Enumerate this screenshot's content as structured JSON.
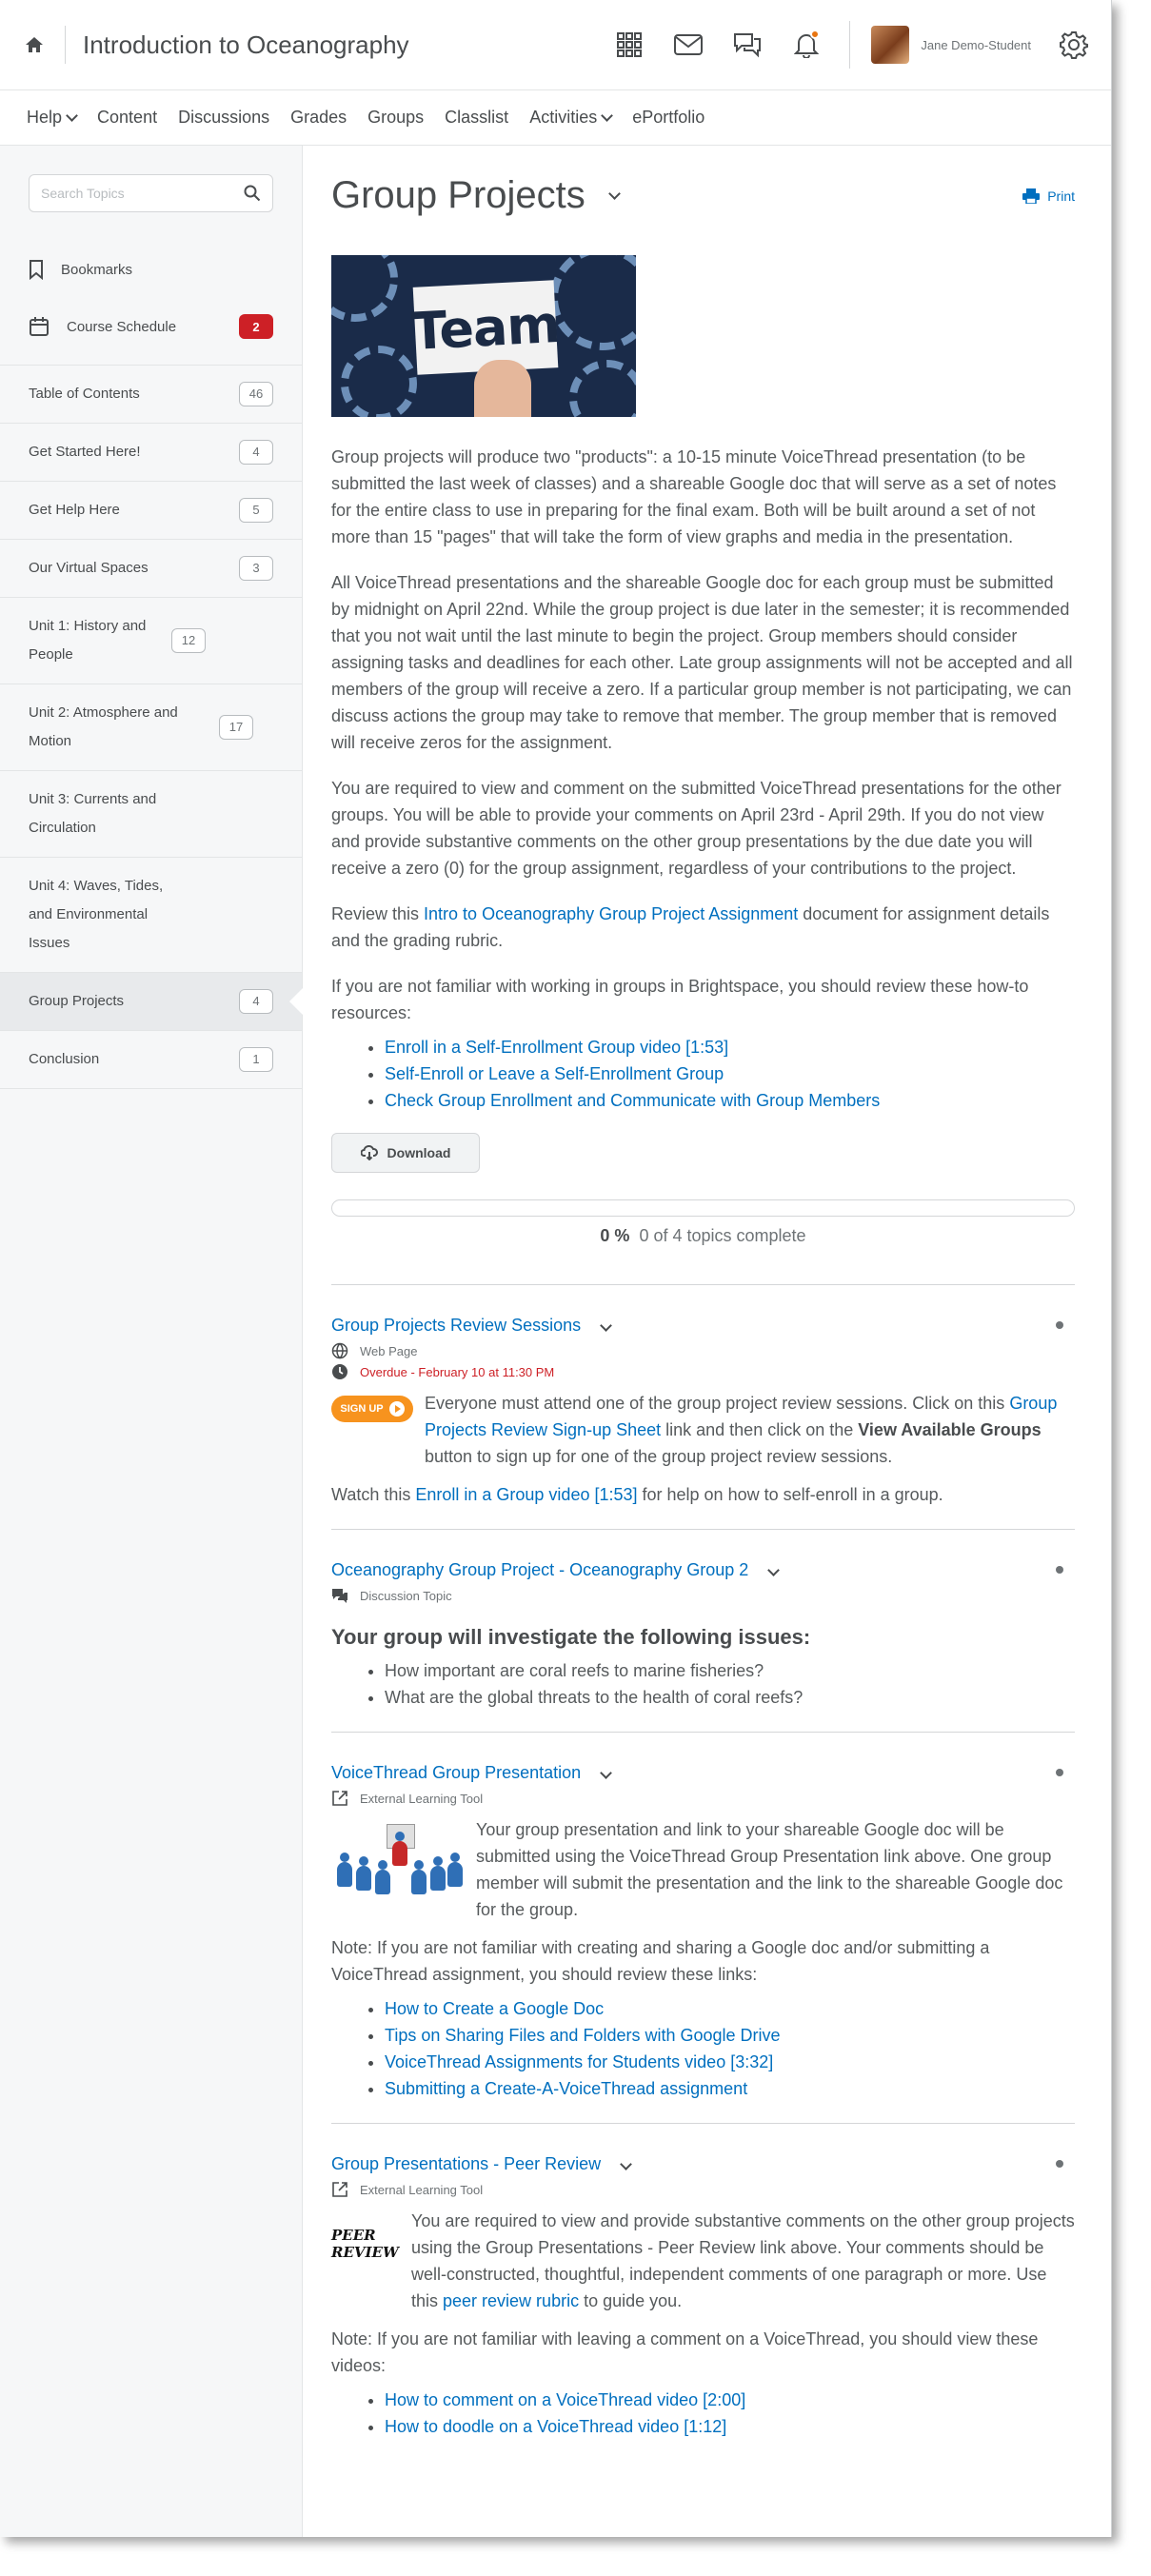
{
  "header": {
    "course_title": "Introduction to Oceanography",
    "user_name": "Jane Demo-Student"
  },
  "navbar": {
    "items": [
      "Help",
      "Content",
      "Discussions",
      "Grades",
      "Groups",
      "Classlist",
      "Activities",
      "ePortfolio"
    ]
  },
  "sidebar": {
    "search_placeholder": "Search Topics",
    "bookmarks_label": "Bookmarks",
    "schedule_label": "Course Schedule",
    "schedule_badge": "2",
    "toc": [
      {
        "label": "Table of Contents",
        "count": "46"
      },
      {
        "label": "Get Started Here!",
        "count": "4"
      },
      {
        "label": "Get Help Here",
        "count": "5"
      },
      {
        "label": "Our Virtual Spaces",
        "count": "3"
      },
      {
        "label": "Unit 1: History and People",
        "count": "12"
      },
      {
        "label": "Unit 2: Atmosphere and Motion",
        "count": "17"
      },
      {
        "label": "Unit 3: Currents and Circulation",
        "count": ""
      },
      {
        "label": "Unit 4: Waves, Tides, and Environmental Issues",
        "count": ""
      },
      {
        "label": "Group Projects",
        "count": "4"
      },
      {
        "label": "Conclusion",
        "count": "1"
      }
    ]
  },
  "main": {
    "title": "Group Projects",
    "print_label": "Print",
    "image_text": "Team",
    "para1": "Group projects will produce two \"products\": a 10-15 minute VoiceThread presentation (to be submitted the last week of classes) and a shareable Google doc that will serve as a set of notes for the entire class to use in preparing for the final exam. Both will be built around a set of not more than 15 \"pages\" that will take the form of view graphs and media in the presentation.",
    "para2": "All VoiceThread presentations and the shareable Google doc for each group must be submitted by midnight on April 22nd. While the group project is due later in the semester; it is recommended that you not wait until the last minute to begin the project. Group members should consider assigning tasks and deadlines for each other. Late group assignments will not be accepted and all members of the group will receive a zero. If a particular group member is not participating, we can discuss actions the group may take to remove that member. The group member that is removed will receive zeros for the assignment.",
    "para3": "You are required to view and comment on the submitted VoiceThread presentations for the other groups.  You will be able to provide your comments on April 23rd - April 29th. If you do not view and provide substantive comments on the other group presentations by the due date you will receive a zero (0) for the group assignment, regardless of your contributions to the project.",
    "para4_pre": "Review this ",
    "para4_link": "Intro to Oceanography Group Project Assignment",
    "para4_post": " document for assignment details and the grading rubric.",
    "para5": "If you are not familiar with working in groups in Brightspace, you should review these how-to resources:",
    "resources": [
      "Enroll in a Self-Enrollment Group video [1:53]",
      "Self-Enroll or Leave a Self-Enrollment Group",
      "Check Group Enrollment and Communicate with Group Members"
    ],
    "download_label": "Download",
    "progress_percent": "0 %",
    "progress_text": "0 of 4 topics complete",
    "progress_fraction": 0
  },
  "topics": [
    {
      "title": "Group Projects Review Sessions",
      "type": "Web Page",
      "due": "Overdue - February 10 at 11:30 PM",
      "signup_label": "SIGN UP",
      "body_pre": "Everyone must attend one of the group project review sessions. Click on this ",
      "body_link": "Group Projects Review Sign-up Sheet",
      "body_mid": " link and then click on the ",
      "body_bold": "View Available Groups",
      "body_post": " button to sign up for one of the group project review sessions.",
      "watch_pre": "Watch this ",
      "watch_link": "Enroll in a Group video [1:53]",
      "watch_post": " for help on how to self-enroll in a group."
    },
    {
      "title": "Oceanography Group Project - Oceanography Group 2",
      "type": "Discussion Topic",
      "subhead": "Your group will investigate the following issues:",
      "issues": [
        "How important are coral reefs to marine fisheries?",
        "What are the global threats to the health of coral reefs?"
      ]
    },
    {
      "title": "VoiceThread Group Presentation",
      "type": "External Learning Tool",
      "body": "Your group presentation and link to your shareable Google doc will be submitted using the VoiceThread Group Presentation link above. One group member will submit the presentation and the link to the shareable Google doc for the group.",
      "note": "Note: If you are not familiar with creating and sharing a Google doc and/or submitting a VoiceThread assignment, you should review these links:",
      "links": [
        "How to Create a Google Doc",
        "Tips on Sharing Files and Folders with Google Drive",
        "VoiceThread Assignments for Students video [3:32]",
        "Submitting a Create-A-VoiceThread assignment"
      ]
    },
    {
      "title": "Group Presentations - Peer Review",
      "type": "External Learning Tool",
      "image_text": "PEER REVIEW",
      "body_pre": "You are required to view and provide substantive comments on the other group projects using the Group Presentations - Peer Review link above. Your comments should be well-constructed, thoughtful, independent comments of one paragraph or more. Use this ",
      "body_link": "peer review rubric",
      "body_post": " to guide you.",
      "note": "Note: If you are not familiar with leaving a comment on a VoiceThread, you should view these videos:",
      "links": [
        "How to comment on a VoiceThread video [2:00]",
        "How to doodle on a VoiceThread video [1:12]"
      ]
    }
  ]
}
